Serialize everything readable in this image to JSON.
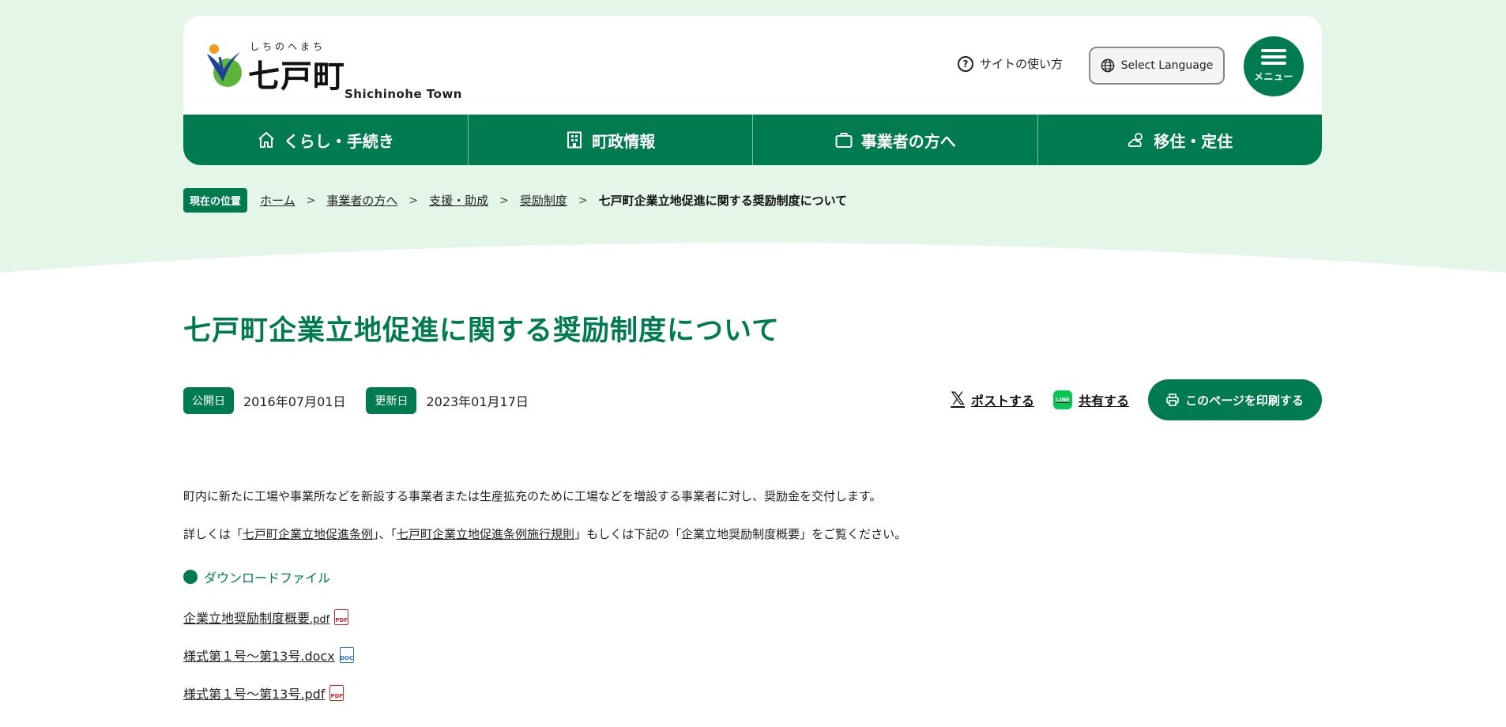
{
  "header": {
    "logo_kana": "しちのへまち",
    "logo_kanji": "七戸町",
    "logo_en": "Shichinohe Town",
    "help_label": "サイトの使い方",
    "help_icon": "?",
    "language_label": "Select Language",
    "menu_label": "メニュー"
  },
  "nav": {
    "items": [
      {
        "label": "くらし・手続き",
        "icon": "home-icon"
      },
      {
        "label": "町政情報",
        "icon": "building-icon"
      },
      {
        "label": "事業者の方へ",
        "icon": "briefcase-icon"
      },
      {
        "label": "移住・定住",
        "icon": "weather-icon"
      }
    ]
  },
  "breadcrumb": {
    "badge": "現在の位置",
    "items": [
      "ホーム",
      "事業者の方へ",
      "支援・助成",
      "奨励制度"
    ],
    "current": "七戸町企業立地促進に関する奨励制度について"
  },
  "page": {
    "title": "七戸町企業立地促進に関する奨励制度について",
    "published_label": "公開日",
    "published_date": "2016年07月01日",
    "updated_label": "更新日",
    "updated_date": "2023年01月17日",
    "share_x": "ポストする",
    "share_line": "共有する",
    "line_icon_text": "LINE",
    "print_label": "このページを印刷する"
  },
  "content": {
    "para1": "町内に新たに工場や事業所などを新設する事業者または生産拡充のために工場などを増設する事業者に対し、奨励金を交付します。",
    "para2_pre": "詳しくは「",
    "para2_link1": "七戸町企業立地促進条例",
    "para2_mid": "」、「",
    "para2_link2": "七戸町企業立地促進条例施行規則",
    "para2_post": "」もしくは下記の「企業立地奨励制度概要」をご覧ください。",
    "download_heading": "ダウンロードファイル",
    "files": [
      {
        "name": "企業立地奨励制度概要",
        "ext": ".pdf",
        "type": "PDF"
      },
      {
        "name": "様式第１号～第13号",
        "ext": ".docx",
        "type": "DOC"
      },
      {
        "name": "様式第１号～第13号",
        "ext": ".pdf",
        "type": "PDF"
      }
    ]
  },
  "colors": {
    "brand_green": "#007b4f",
    "bg_mint": "#e3f6e8"
  }
}
